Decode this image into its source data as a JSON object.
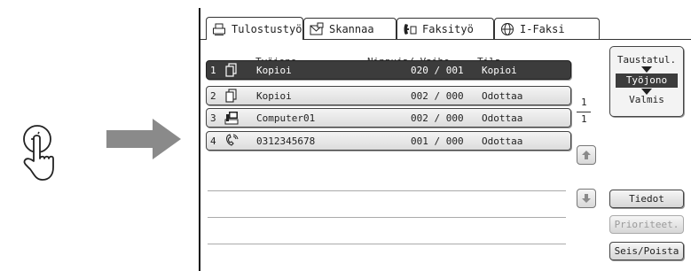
{
  "tabs": [
    {
      "label": "Tulostustyö",
      "icon": "printer-icon"
    },
    {
      "label": "Skannaa",
      "icon": "scan-envelope-icon"
    },
    {
      "label": "Faksityö",
      "icon": "fax-icon"
    },
    {
      "label": "I-Faksi",
      "icon": "globe-icon"
    }
  ],
  "columns": {
    "queue": "Työjono",
    "sets_step": "Nippuja/ Vaihe",
    "status": "Tila"
  },
  "jobs": [
    {
      "num": "1",
      "icon": "copy-icon",
      "name": "Kopioi",
      "count": "020 / 001",
      "status": "Kopioi",
      "selected": true
    },
    {
      "num": "2",
      "icon": "copy-icon",
      "name": "Kopioi",
      "count": "002 / 000",
      "status": "Odottaa",
      "selected": false
    },
    {
      "num": "3",
      "icon": "computer-icon",
      "name": "Computer01",
      "count": "002 / 000",
      "status": "Odottaa",
      "selected": false
    },
    {
      "num": "4",
      "icon": "fax-phone-icon",
      "name": "0312345678",
      "count": "001 / 000",
      "status": "Odottaa",
      "selected": false
    }
  ],
  "pagination": {
    "current": "1",
    "total": "1"
  },
  "sort": {
    "top": "Taustatul.",
    "selected": "Työjono",
    "bottom": "Valmis"
  },
  "buttons": {
    "details": "Tiedot",
    "priority": "Prioriteet.",
    "stop_delete": "Seis/Poista"
  },
  "colors": {
    "selected_row": "#3c3c3c",
    "arrow_gray": "#8a8a8a"
  }
}
